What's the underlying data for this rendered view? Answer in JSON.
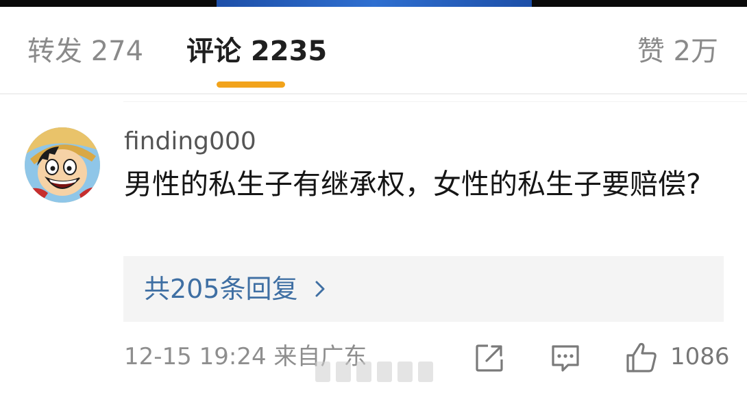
{
  "tabs": {
    "repost": "转发 274",
    "comment": "评论 2235",
    "like": "赞 2万"
  },
  "comment": {
    "username": "finding000",
    "text": "男性的私生子有继承权，女性的私生子要赔偿?",
    "replies_label": "共205条回复",
    "timestamp": "12-15 19:24",
    "location": "来自广东",
    "like_count": "1086"
  },
  "icons": {
    "replies_chevron": "chevron-right-icon",
    "share": "share-icon",
    "reply": "comment-bubble-icon",
    "like": "thumbs-up-icon"
  },
  "colors": {
    "accent_indicator": "#f2a31b",
    "link_blue": "#3f6fa3",
    "text_primary": "#151515",
    "text_secondary": "#8e8e8e"
  }
}
